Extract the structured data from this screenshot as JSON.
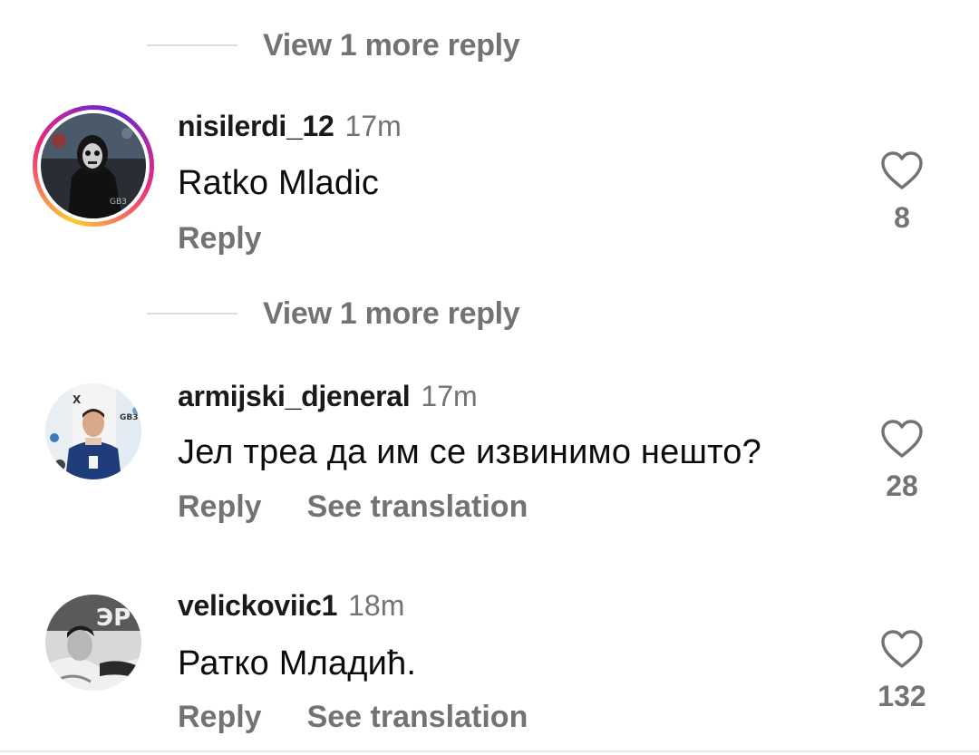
{
  "view_more_label": "View 1 more reply",
  "comments": [
    {
      "username": "nisilerdi_12",
      "time": "17m",
      "text": "Ratko Mladic",
      "reply": "Reply",
      "likes": "8",
      "has_story": true
    },
    {
      "username": "armijski_djeneral",
      "time": "17m",
      "text": "Јел треа да им се извинимо нешто?",
      "reply": "Reply",
      "translate": "See translation",
      "likes": "28",
      "has_story": false
    },
    {
      "username": "velickoviic1",
      "time": "18m",
      "text": "Ратко Младић.",
      "reply": "Reply",
      "translate": "See translation",
      "likes": "132",
      "has_story": false
    }
  ],
  "colors": {
    "secondary_text": "#737373",
    "primary_text": "#0c0c0c",
    "divider": "#dedede"
  }
}
